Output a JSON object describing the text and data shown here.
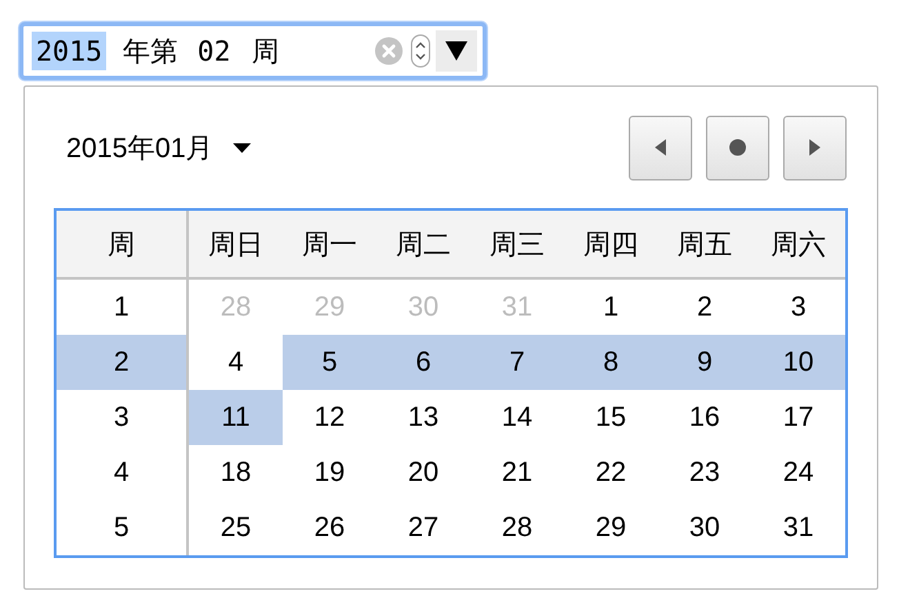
{
  "week_field": {
    "segments": [
      {
        "text": "2015",
        "selected": true
      },
      {
        "text": "年第",
        "selected": false
      },
      {
        "text": "02",
        "selected": false
      },
      {
        "text": "周",
        "selected": false
      }
    ]
  },
  "picker": {
    "month_label": "2015年01月",
    "header": [
      "周",
      "周日",
      "周一",
      "周二",
      "周三",
      "周四",
      "周五",
      "周六"
    ],
    "weeks": [
      {
        "week": "1",
        "selected": false,
        "days": [
          {
            "text": "28",
            "other_month": true,
            "selected": false
          },
          {
            "text": "29",
            "other_month": true,
            "selected": false
          },
          {
            "text": "30",
            "other_month": true,
            "selected": false
          },
          {
            "text": "31",
            "other_month": true,
            "selected": false
          },
          {
            "text": "1",
            "other_month": false,
            "selected": false
          },
          {
            "text": "2",
            "other_month": false,
            "selected": false
          },
          {
            "text": "3",
            "other_month": false,
            "selected": false
          }
        ]
      },
      {
        "week": "2",
        "selected": true,
        "days": [
          {
            "text": "4",
            "other_month": false,
            "selected": false
          },
          {
            "text": "5",
            "other_month": false,
            "selected": true
          },
          {
            "text": "6",
            "other_month": false,
            "selected": true
          },
          {
            "text": "7",
            "other_month": false,
            "selected": true
          },
          {
            "text": "8",
            "other_month": false,
            "selected": true
          },
          {
            "text": "9",
            "other_month": false,
            "selected": true
          },
          {
            "text": "10",
            "other_month": false,
            "selected": true
          }
        ]
      },
      {
        "week": "3",
        "selected": false,
        "days": [
          {
            "text": "11",
            "other_month": false,
            "selected": true
          },
          {
            "text": "12",
            "other_month": false,
            "selected": false
          },
          {
            "text": "13",
            "other_month": false,
            "selected": false
          },
          {
            "text": "14",
            "other_month": false,
            "selected": false
          },
          {
            "text": "15",
            "other_month": false,
            "selected": false
          },
          {
            "text": "16",
            "other_month": false,
            "selected": false
          },
          {
            "text": "17",
            "other_month": false,
            "selected": false
          }
        ]
      },
      {
        "week": "4",
        "selected": false,
        "days": [
          {
            "text": "18",
            "other_month": false,
            "selected": false
          },
          {
            "text": "19",
            "other_month": false,
            "selected": false
          },
          {
            "text": "20",
            "other_month": false,
            "selected": false
          },
          {
            "text": "21",
            "other_month": false,
            "selected": false
          },
          {
            "text": "22",
            "other_month": false,
            "selected": false
          },
          {
            "text": "23",
            "other_month": false,
            "selected": false
          },
          {
            "text": "24",
            "other_month": false,
            "selected": false
          }
        ]
      },
      {
        "week": "5",
        "selected": false,
        "days": [
          {
            "text": "25",
            "other_month": false,
            "selected": false
          },
          {
            "text": "26",
            "other_month": false,
            "selected": false
          },
          {
            "text": "27",
            "other_month": false,
            "selected": false
          },
          {
            "text": "28",
            "other_month": false,
            "selected": false
          },
          {
            "text": "29",
            "other_month": false,
            "selected": false
          },
          {
            "text": "30",
            "other_month": false,
            "selected": false
          },
          {
            "text": "31",
            "other_month": false,
            "selected": false
          }
        ]
      }
    ]
  }
}
